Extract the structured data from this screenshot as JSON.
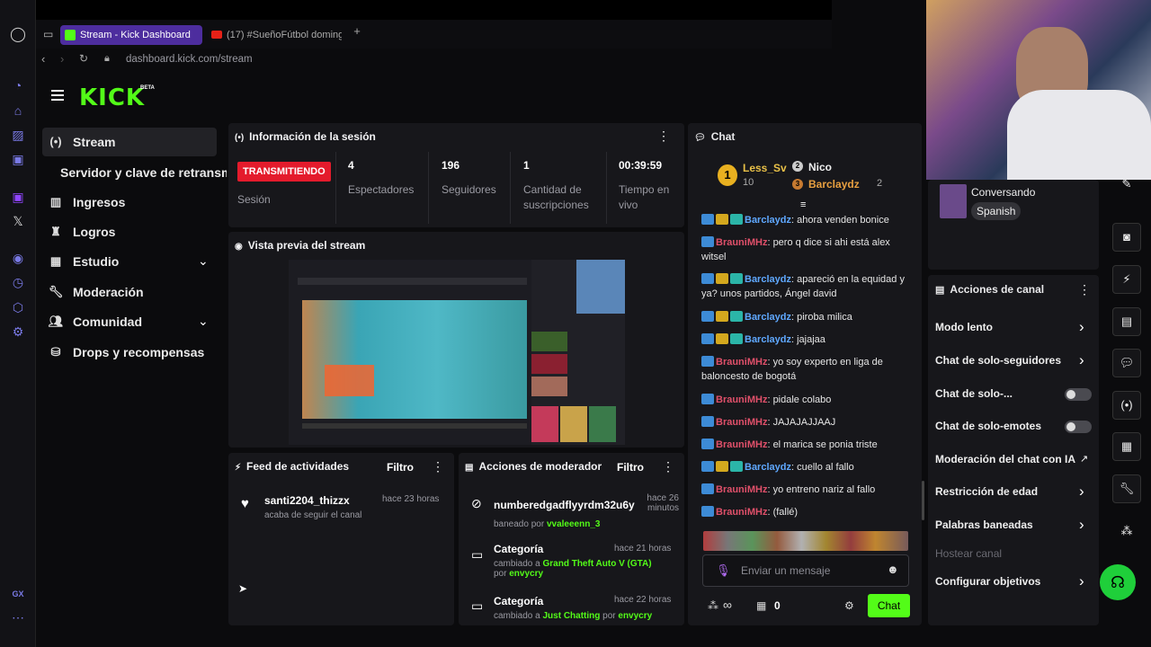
{
  "browser": {
    "tabs": [
      {
        "label": "Stream - Kick Dashboard"
      },
      {
        "label": "(17) #SueñoFútbol doming"
      }
    ],
    "new_tab": "+",
    "url": "dashboard.kick.com/stream"
  },
  "brand": {
    "logo": "KICK",
    "beta": "BETA",
    "accent": "#53fc18"
  },
  "sidebar": {
    "items": [
      {
        "label": "Stream",
        "icon": "broadcast-icon"
      },
      {
        "label": "Servidor y clave de retransm"
      },
      {
        "label": "Ingresos",
        "icon": "chart-icon"
      },
      {
        "label": "Logros",
        "icon": "trophy-icon"
      },
      {
        "label": "Estudio",
        "icon": "film-icon"
      },
      {
        "label": "Moderación",
        "icon": "wrench-icon"
      },
      {
        "label": "Comunidad",
        "icon": "users-icon"
      },
      {
        "label": "Drops y recompensas",
        "icon": "gift-icon"
      }
    ]
  },
  "session": {
    "title": "Información de la sesión",
    "live_badge": "TRANSMITIENDO",
    "session_label": "Sesión",
    "stats": [
      {
        "value": "4",
        "label": "Espectadores"
      },
      {
        "value": "196",
        "label": "Seguidores"
      },
      {
        "value": "1",
        "label": "Cantidad de suscripciones"
      },
      {
        "value": "00:39:59",
        "label": "Tiempo en vivo"
      }
    ]
  },
  "preview": {
    "title": "Vista previa del stream"
  },
  "feed": {
    "title": "Feed de actividades",
    "filter": "Filtro",
    "items": [
      {
        "user": "santi2204_thizzx",
        "time": "hace 23 horas",
        "desc": "acaba de seguir el canal"
      }
    ]
  },
  "modactions": {
    "title": "Acciones de moderador",
    "filter": "Filtro",
    "items": [
      {
        "title": "numberedgadflyyrdm32u6y",
        "time": "hace 26 minutos",
        "pre": "baneado por",
        "by": "vvaleeenn_3"
      },
      {
        "title": "Categoría",
        "time": "hace 21 horas",
        "pre": "cambiado a",
        "target": "Grand Theft Auto V (GTA)",
        "mid": "por",
        "by": "envycry"
      },
      {
        "title": "Categoría",
        "time": "hace 22 horas",
        "pre": "cambiado a",
        "target": "Just Chatting",
        "mid": "por",
        "by": "envycry"
      }
    ]
  },
  "chat": {
    "title": "Chat",
    "top": [
      {
        "rank": "1",
        "name": "Less_Sv",
        "count": "10"
      },
      {
        "rank": "2",
        "name": "Nico"
      },
      {
        "rank": "3",
        "name": "Barclaydz",
        "count": "2"
      }
    ],
    "messages": [
      {
        "user": "Barclaydz",
        "color": "blue",
        "text": ": ahora venden bonice"
      },
      {
        "user": "BrauniMHz",
        "color": "red",
        "text": ": pero q dice si ahi está alex witsel"
      },
      {
        "user": "Barclaydz",
        "color": "blue",
        "text": ": apareció en la equidad y ya? unos partidos, Ángel david"
      },
      {
        "user": "Barclaydz",
        "color": "blue",
        "text": ": piroba milica"
      },
      {
        "user": "Barclaydz",
        "color": "blue",
        "text": ": jajajaa"
      },
      {
        "user": "BrauniMHz",
        "color": "red",
        "text": ": yo soy experto en liga de baloncesto de bogotá"
      },
      {
        "user": "BrauniMHz",
        "color": "red",
        "text": ": pidale colabo"
      },
      {
        "user": "BrauniMHz",
        "color": "red",
        "text": ": JAJAJAJJAAJ"
      },
      {
        "user": "BrauniMHz",
        "color": "red",
        "text": ": el marica se ponia triste"
      },
      {
        "user": "Barclaydz",
        "color": "blue",
        "text": ": cuello al fallo"
      },
      {
        "user": "BrauniMHz",
        "color": "red",
        "text": ": yo entreno nariz al fallo"
      },
      {
        "user": "BrauniMHz",
        "color": "red",
        "text": ": (fallé)"
      }
    ],
    "input_placeholder": "Enviar un mensaje",
    "infinity": "∞",
    "gifts": "0",
    "send": "Chat"
  },
  "category": {
    "label": "Conversando",
    "tag": "Spanish"
  },
  "channel_actions": {
    "title": "Acciones de canal",
    "items": [
      {
        "label": "Modo lento",
        "type": "chevron"
      },
      {
        "label": "Chat de solo-seguidores",
        "type": "chevron"
      },
      {
        "label": "Chat de solo-...",
        "type": "toggle"
      },
      {
        "label": "Chat de solo-emotes",
        "type": "toggle"
      },
      {
        "label": "Moderación del chat con IA",
        "type": "external"
      },
      {
        "label": "Restricción de edad",
        "type": "chevron"
      },
      {
        "label": "Palabras baneadas",
        "type": "chevron"
      },
      {
        "label": "Hostear canal",
        "type": "disabled"
      },
      {
        "label": "Configurar objetivos",
        "type": "chevron"
      }
    ]
  },
  "opera_gx": "GX"
}
